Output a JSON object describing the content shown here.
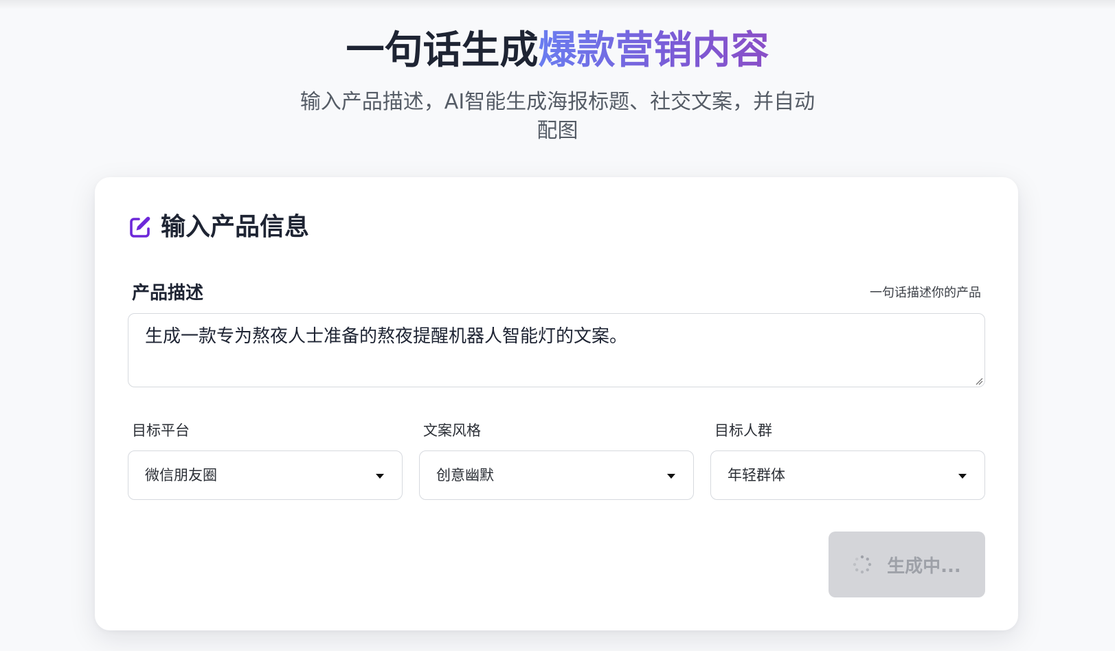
{
  "hero": {
    "title_main": "一句话生成",
    "title_accent": "爆款营销内容",
    "subtitle": "输入产品描述，AI智能生成海报标题、社交文案，并自动配图"
  },
  "card": {
    "title": "输入产品信息",
    "icon": "edit-icon",
    "description": {
      "label": "产品描述",
      "hint": "一句话描述你的产品",
      "value": "生成一款专为熬夜人士准备的熬夜提醒机器人智能灯的文案。"
    },
    "selects": [
      {
        "label": "目标平台",
        "value": "微信朋友圈"
      },
      {
        "label": "文案风格",
        "value": "创意幽默"
      },
      {
        "label": "目标人群",
        "value": "年轻群体"
      }
    ],
    "generate_button": {
      "label": "生成中...",
      "state": "loading",
      "icon": "spinner-icon"
    }
  },
  "colors": {
    "accent_start": "#6a7df0",
    "accent_end": "#8a4fc7",
    "icon_purple": "#6d28d9",
    "button_disabled_bg": "#d4d5d9",
    "button_disabled_text": "#9ea1a8"
  }
}
